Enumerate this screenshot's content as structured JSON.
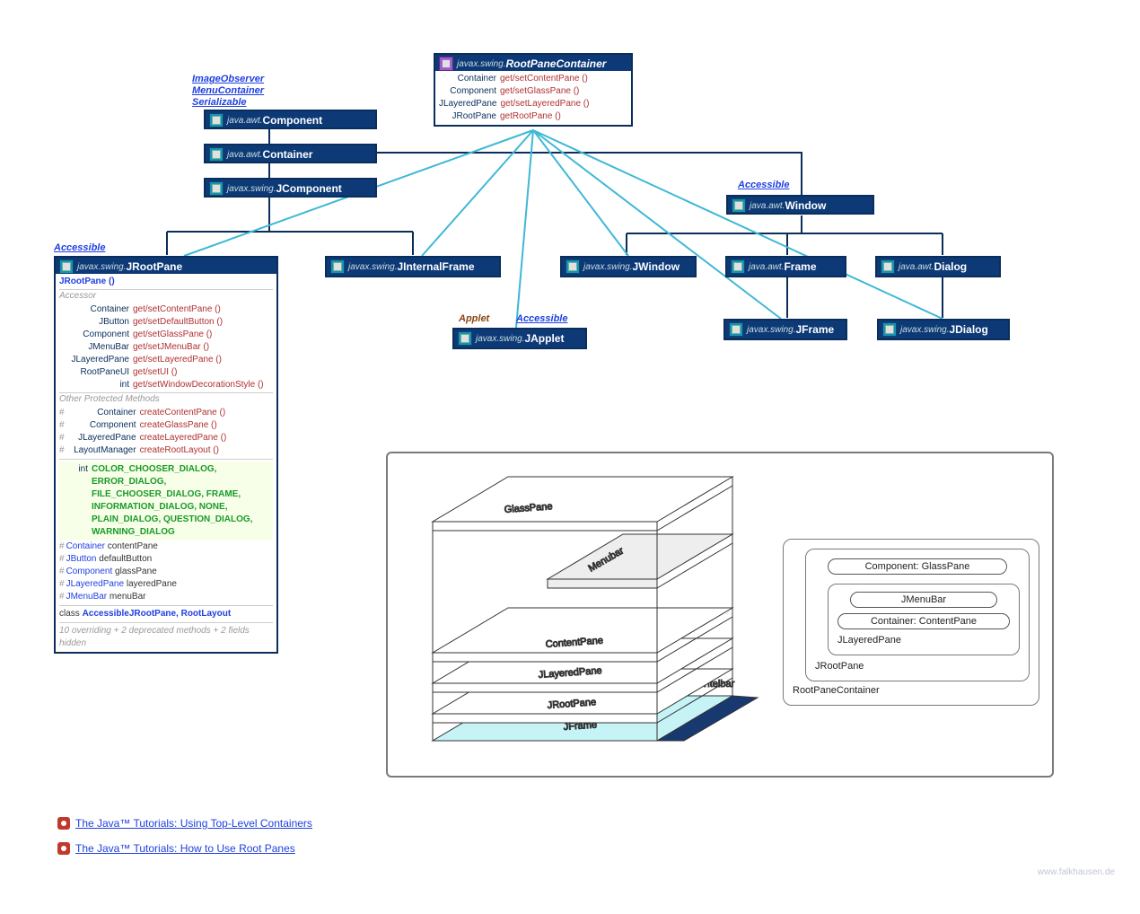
{
  "colors": {
    "headerBg": "#0d3a77",
    "headerBorder": "#0a2e5c",
    "linkInterface": "#2040e0"
  },
  "componentLabels": {
    "imageObserver": "ImageObserver",
    "menuContainer": "MenuContainer",
    "serializable": "Serializable",
    "accessible1": "Accessible",
    "accessible2": "Accessible",
    "accessible3": "Accessible",
    "applet": "Applet"
  },
  "classes": {
    "rootPaneContainer": {
      "pkg": "javax.swing.",
      "name": "RootPaneContainer"
    },
    "component": {
      "pkg": "java.awt.",
      "name": "Component"
    },
    "container": {
      "pkg": "java.awt.",
      "name": "Container"
    },
    "jcomponent": {
      "pkg": "javax.swing.",
      "name": "JComponent"
    },
    "jrootpane": {
      "pkg": "javax.swing.",
      "name": "JRootPane"
    },
    "jinternalframe": {
      "pkg": "javax.swing.",
      "name": "JInternalFrame"
    },
    "japplet": {
      "pkg": "javax.swing.",
      "name": "JApplet"
    },
    "window": {
      "pkg": "java.awt.",
      "name": "Window"
    },
    "jwindow": {
      "pkg": "javax.swing.",
      "name": "JWindow"
    },
    "frame": {
      "pkg": "java.awt.",
      "name": "Frame"
    },
    "jframe": {
      "pkg": "javax.swing.",
      "name": "JFrame"
    },
    "dialog": {
      "pkg": "java.awt.",
      "name": "Dialog"
    },
    "jdialog": {
      "pkg": "javax.swing.",
      "name": "JDialog"
    }
  },
  "rootPaneContainerBody": {
    "rows": [
      {
        "ret": "Container",
        "name": "get/setContentPane ()"
      },
      {
        "ret": "Component",
        "name": "get/setGlassPane ()"
      },
      {
        "ret": "JLayeredPane",
        "name": "get/setLayeredPane ()"
      },
      {
        "ret": "JRootPane",
        "name": "getRootPane ()"
      }
    ]
  },
  "jrootpaneBody": {
    "ctor": "JRootPane ()",
    "sectAccessor": "Accessor",
    "accessor": [
      {
        "ret": "Container",
        "name": "get/setContentPane ()"
      },
      {
        "ret": "JButton",
        "name": "get/setDefaultButton ()"
      },
      {
        "ret": "Component",
        "name": "get/setGlassPane ()"
      },
      {
        "ret": "JMenuBar",
        "name": "get/setJMenuBar ()"
      },
      {
        "ret": "JLayeredPane",
        "name": "get/setLayeredPane ()"
      },
      {
        "ret": "RootPaneUI",
        "name": "get/setUI ()"
      },
      {
        "ret": "int",
        "name": "get/setWindowDecorationStyle ()"
      }
    ],
    "sectOther": "Other Protected Methods",
    "other": [
      {
        "ret": "Container",
        "name": "createContentPane ()"
      },
      {
        "ret": "Component",
        "name": "createGlassPane ()"
      },
      {
        "ret": "JLayeredPane",
        "name": "createLayeredPane ()"
      },
      {
        "ret": "LayoutManager",
        "name": "createRootLayout ()"
      }
    ],
    "constType": "int",
    "consts": "COLOR_CHOOSER_DIALOG, ERROR_DIALOG, FILE_CHOOSER_DIALOG, FRAME, INFORMATION_DIALOG, NONE, PLAIN_DIALOG, QUESTION_DIALOG, WARNING_DIALOG",
    "fields": [
      {
        "type": "Container",
        "name": "contentPane"
      },
      {
        "type": "JButton",
        "name": "defaultButton"
      },
      {
        "type": "Component",
        "name": "glassPane"
      },
      {
        "type": "JLayeredPane",
        "name": "layeredPane"
      },
      {
        "type": "JMenuBar",
        "name": "menuBar"
      }
    ],
    "innerLabel": "class",
    "innerClasses": "AccessibleJRootPane, RootLayout",
    "footnote": "10 overriding + 2 deprecated methods + 2 fields hidden"
  },
  "layers3d": {
    "glassPane": "GlassPane",
    "menubar": "Menubar",
    "contentPane": "ContentPane",
    "jlayeredPane": "JLayeredPane",
    "jrootpane": "JRootPane",
    "jframe": "JFrame",
    "titlebar": "Titelbar"
  },
  "nested": {
    "rootPaneContainer": "RootPaneContainer",
    "jrootpane": "JRootPane",
    "jlayeredpane": "JLayeredPane",
    "jmenubar": "JMenuBar",
    "contentpane": "Container: ContentPane",
    "glasspane": "Component: GlassPane"
  },
  "tutorials": {
    "t1": "The Java™ Tutorials: Using Top-Level Containers",
    "t2": "The Java™ Tutorials: How to Use Root Panes"
  },
  "footerUrl": "www.falkhausen.de"
}
